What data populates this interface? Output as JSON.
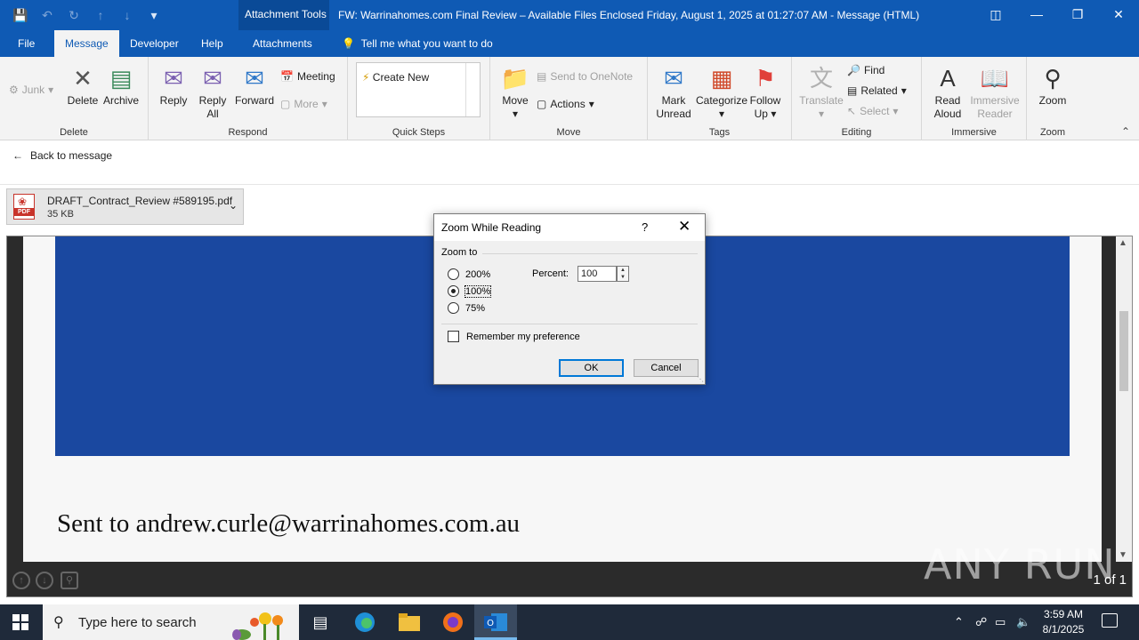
{
  "window": {
    "title": "FW: Warrinahomes.com Final Review – Available Files Enclosed Friday, August 1, 2025 at 01:27:07 AM  -  Message (HTML)",
    "context_tab": "Attachment Tools"
  },
  "tabs": [
    "File",
    "Message",
    "Developer",
    "Help",
    "Attachments"
  ],
  "tell_me": "Tell me what you want to do",
  "ribbon": {
    "delete_group": {
      "label": "Delete",
      "junk": "Junk",
      "delete": "Delete",
      "archive": "Archive"
    },
    "respond_group": {
      "label": "Respond",
      "reply": "Reply",
      "reply_all_1": "Reply",
      "reply_all_2": "All",
      "forward": "Forward",
      "meeting": "Meeting",
      "more": "More"
    },
    "quicksteps_group": {
      "label": "Quick Steps",
      "create_new": "Create New"
    },
    "move_group": {
      "label": "Move",
      "move": "Move",
      "onenote": "Send to OneNote",
      "actions": "Actions"
    },
    "tags_group": {
      "label": "Tags",
      "mark_unread_1": "Mark",
      "mark_unread_2": "Unread",
      "categorize": "Categorize",
      "follow_up_1": "Follow",
      "follow_up_2": "Up"
    },
    "editing_group": {
      "label": "Editing",
      "translate": "Translate",
      "find": "Find",
      "related": "Related",
      "select": "Select"
    },
    "immersive_group": {
      "label": "Immersive",
      "read_aloud_1": "Read",
      "read_aloud_2": "Aloud",
      "immersive_reader_1": "Immersive",
      "immersive_reader_2": "Reader"
    },
    "zoom_group": {
      "label": "Zoom",
      "zoom": "Zoom"
    }
  },
  "back_to_message": "Back to message",
  "attachment": {
    "name": "DRAFT_Contract_Review #589195.pdf",
    "size": "35 KB",
    "icon_label": "PDF"
  },
  "preview": {
    "sent_text": "Sent to andrew.curle@warrinahomes.com.au",
    "page_info": "1 of 1",
    "watermark": "ANY RUN"
  },
  "dialog": {
    "title": "Zoom While Reading",
    "help": "?",
    "group_label": "Zoom to",
    "options": [
      "200%",
      "100%",
      "75%"
    ],
    "selected": "100%",
    "percent_label": "Percent:",
    "percent_value": "100",
    "remember": "Remember my preference",
    "ok": "OK",
    "cancel": "Cancel"
  },
  "taskbar": {
    "search_placeholder": "Type here to search",
    "time": "3:59 AM",
    "date": "8/1/2025"
  },
  "colors": {
    "titlebar": "#0f5ab4",
    "accent_blue_box": "#1a48a0",
    "taskbar": "#1f2a3a"
  }
}
